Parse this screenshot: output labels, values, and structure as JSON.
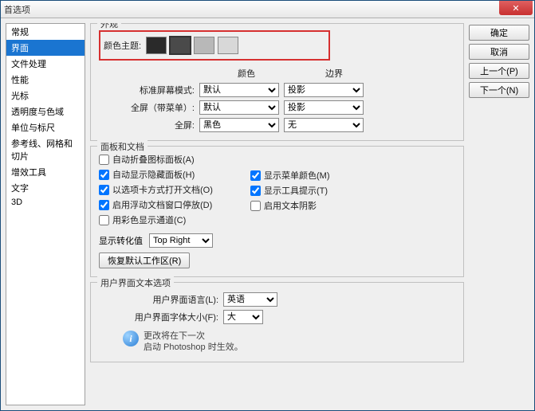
{
  "window": {
    "title": "首选项"
  },
  "sidebar": {
    "items": [
      {
        "label": "常规"
      },
      {
        "label": "界面"
      },
      {
        "label": "文件处理"
      },
      {
        "label": "性能"
      },
      {
        "label": "光标"
      },
      {
        "label": "透明度与色域"
      },
      {
        "label": "单位与标尺"
      },
      {
        "label": "参考线、网格和切片"
      },
      {
        "label": "增效工具"
      },
      {
        "label": "文字"
      },
      {
        "label": "3D"
      }
    ],
    "selected": 1
  },
  "buttons": {
    "ok": "确定",
    "cancel": "取消",
    "prev": "上一个(P)",
    "next": "下一个(N)"
  },
  "appearance": {
    "group_title": "外观",
    "theme_label": "颜色主题:",
    "swatches": [
      "#2a2a2a",
      "#4a4a4a",
      "#b8b8b8",
      "#d8d8d8"
    ],
    "selected_swatch": 1,
    "col_color": "颜色",
    "col_border": "边界",
    "rows": [
      {
        "label": "标准屏幕模式:",
        "color": "默认",
        "border": "投影"
      },
      {
        "label": "全屏（带菜单）:",
        "color": "默认",
        "border": "投影"
      },
      {
        "label": "全屏:",
        "color": "黑色",
        "border": "无"
      }
    ]
  },
  "panels": {
    "group_title": "面板和文档",
    "checks": [
      {
        "label": "自动折叠图标面板(A)",
        "checked": false
      },
      {
        "label": "自动显示隐藏面板(H)",
        "checked": true
      },
      {
        "label": "以选项卡方式打开文档(O)",
        "checked": true
      },
      {
        "label": "启用浮动文档窗口停放(D)",
        "checked": true
      },
      {
        "label": "用彩色显示通道(C)",
        "checked": false
      }
    ],
    "checks_r": [
      {
        "label": "显示菜单颜色(M)",
        "checked": true
      },
      {
        "label": "显示工具提示(T)",
        "checked": true
      },
      {
        "label": "启用文本阴影",
        "checked": false
      }
    ],
    "convert_label": "显示转化值",
    "convert_value": "Top Right",
    "restore_btn": "恢复默认工作区(R)"
  },
  "textopts": {
    "group_title": "用户界面文本选项",
    "lang_label": "用户界面语言(L):",
    "lang_value": "英语",
    "size_label": "用户界面字体大小(F):",
    "size_value": "大",
    "info_line1": "更改将在下一次",
    "info_line2": "启动 Photoshop 时生效。"
  }
}
